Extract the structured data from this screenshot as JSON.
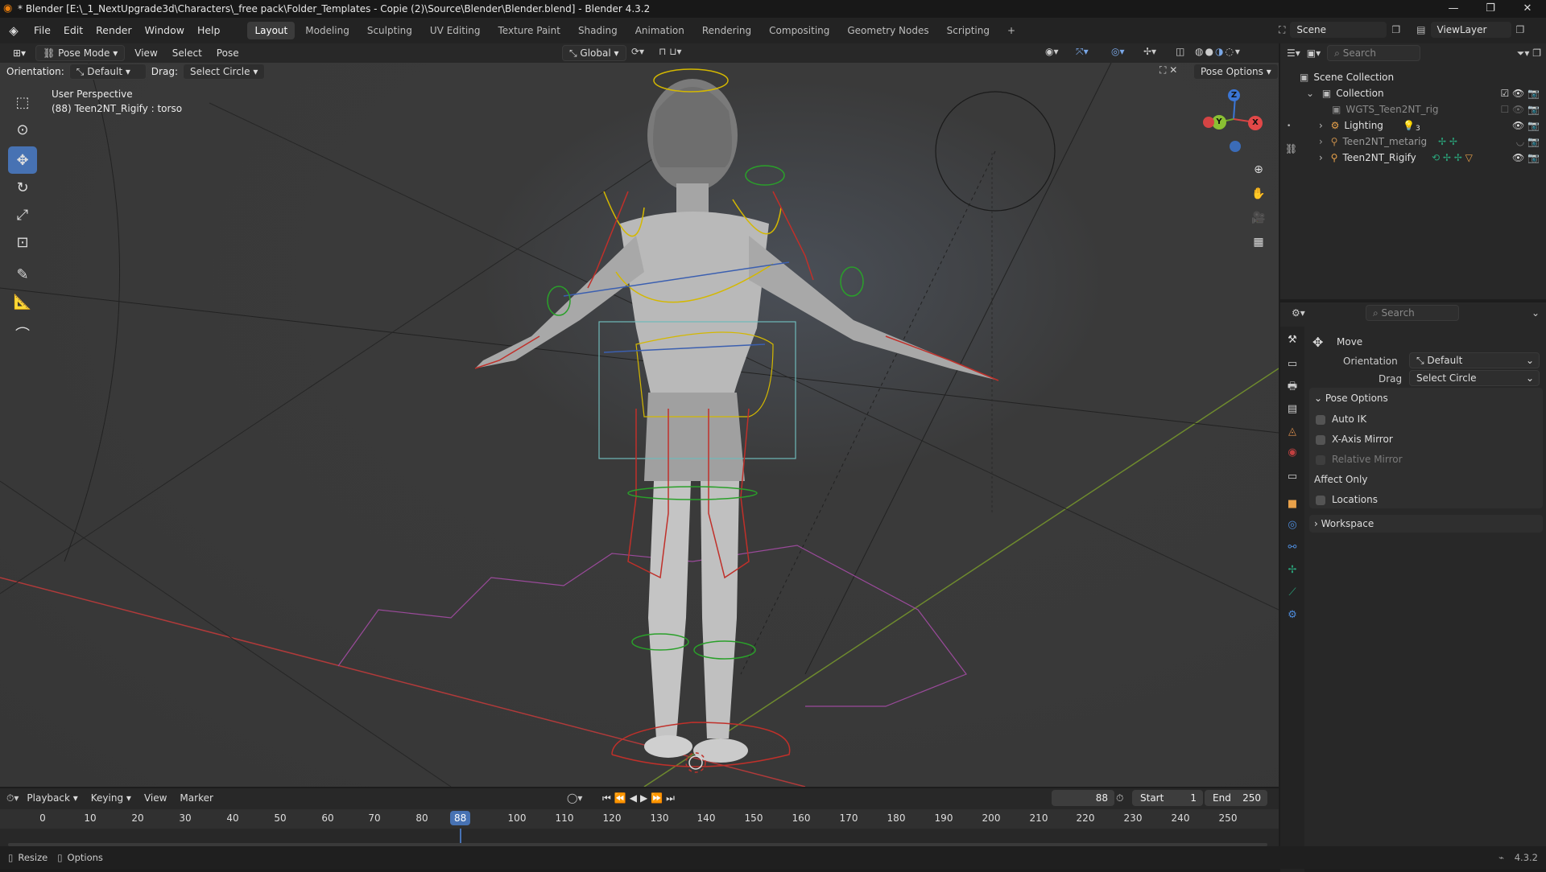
{
  "window": {
    "title": "* Blender [E:\\_1_NextUpgrade3d\\Characters\\_free pack\\Folder_Templates - Copie (2)\\Source\\Blender\\Blender.blend] - Blender 4.3.2",
    "minimize": "—",
    "maximize": "❐",
    "close": "✕"
  },
  "menu": {
    "items": [
      "File",
      "Edit",
      "Render",
      "Window",
      "Help"
    ],
    "workspaces": [
      "Layout",
      "Modeling",
      "Sculpting",
      "UV Editing",
      "Texture Paint",
      "Shading",
      "Animation",
      "Rendering",
      "Compositing",
      "Geometry Nodes",
      "Scripting"
    ],
    "add_workspace": "+",
    "scene": "Scene",
    "view_layer": "ViewLayer"
  },
  "viewport_header": {
    "mode": "Pose Mode",
    "menus": [
      "View",
      "Select",
      "Pose"
    ],
    "transform_orientation": "Global",
    "orientation_label": "Orientation:",
    "orientation_value": "Default",
    "drag_label": "Drag:",
    "drag_value": "Select Circle",
    "pose_options": "Pose Options"
  },
  "viewport": {
    "perspective": "User Perspective",
    "active_object": "(88) Teen2NT_Rigify : torso",
    "gizmo": {
      "z": "Z",
      "y": "Y",
      "x": "X"
    }
  },
  "outliner": {
    "search_placeholder": "Search",
    "rows": [
      {
        "label": "Scene Collection"
      },
      {
        "label": "Collection"
      },
      {
        "label": "WGTS_Teen2NT_rig"
      },
      {
        "label": "Lighting",
        "badge": "3"
      },
      {
        "label": "Teen2NT_metarig"
      },
      {
        "label": "Teen2NT_Rigify"
      }
    ]
  },
  "properties": {
    "search_placeholder": "Search",
    "tool_name": "Move",
    "orientation_label": "Orientation",
    "orientation_value": "Default",
    "drag_label": "Drag",
    "drag_value": "Select Circle",
    "pose_options_title": "Pose Options",
    "auto_ik": "Auto IK",
    "x_axis_mirror": "X-Axis Mirror",
    "relative_mirror": "Relative Mirror",
    "affect_only": "Affect Only",
    "locations": "Locations",
    "workspace": "Workspace"
  },
  "timeline": {
    "menus": [
      "Playback",
      "Keying",
      "View",
      "Marker"
    ],
    "current_frame": "88",
    "start_label": "Start",
    "start": "1",
    "end_label": "End",
    "end": "250",
    "ruler": [
      "0",
      "10",
      "20",
      "30",
      "40",
      "50",
      "60",
      "70",
      "80",
      "100",
      "110",
      "120",
      "130",
      "140",
      "150",
      "160",
      "170",
      "180",
      "190",
      "200",
      "210",
      "220",
      "230",
      "240",
      "250"
    ],
    "playhead": "88"
  },
  "status": {
    "resize": "Resize",
    "options": "Options",
    "version": "4.3.2"
  }
}
